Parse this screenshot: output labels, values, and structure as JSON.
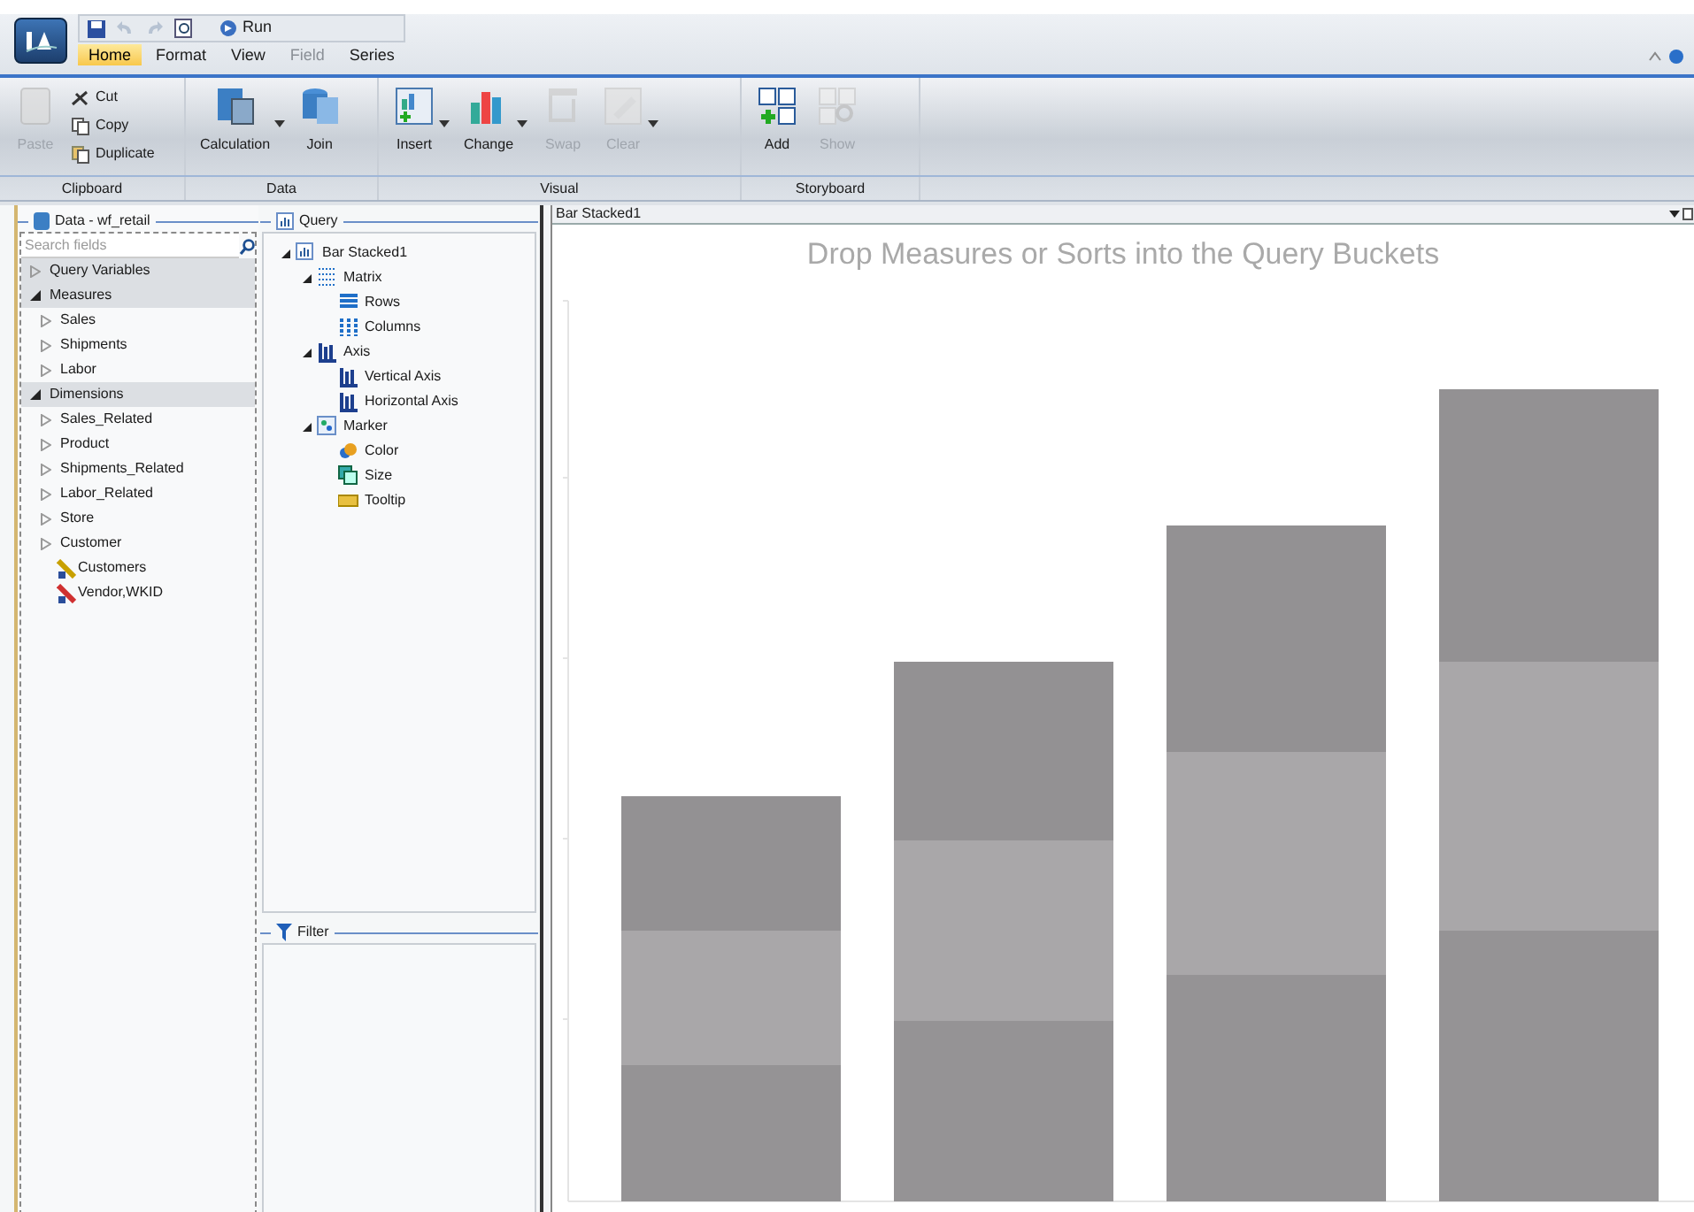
{
  "quick_access": {
    "run_label": "Run"
  },
  "tabs": [
    {
      "label": "Home",
      "selected": true,
      "disabled": false
    },
    {
      "label": "Format",
      "selected": false,
      "disabled": false
    },
    {
      "label": "View",
      "selected": false,
      "disabled": false
    },
    {
      "label": "Field",
      "selected": false,
      "disabled": true
    },
    {
      "label": "Series",
      "selected": false,
      "disabled": false
    }
  ],
  "ribbon_groups": [
    {
      "label": "Clipboard",
      "buttons": [
        {
          "label": "Paste",
          "kind": "large",
          "disabled": true
        },
        {
          "label": "Cut",
          "kind": "small",
          "disabled": false
        },
        {
          "label": "Copy",
          "kind": "small",
          "disabled": false
        },
        {
          "label": "Duplicate",
          "kind": "small",
          "disabled": false
        }
      ]
    },
    {
      "label": "Data",
      "buttons": [
        {
          "label": "Calculation",
          "kind": "large",
          "disabled": false,
          "dropdown": true
        },
        {
          "label": "Join",
          "kind": "large",
          "disabled": false
        }
      ]
    },
    {
      "label": "Visual",
      "buttons": [
        {
          "label": "Insert",
          "kind": "large",
          "disabled": false,
          "dropdown": true
        },
        {
          "label": "Change",
          "kind": "large",
          "disabled": false,
          "dropdown": true
        },
        {
          "label": "Swap",
          "kind": "large",
          "disabled": true
        },
        {
          "label": "Clear",
          "kind": "large",
          "disabled": true,
          "dropdown": true
        }
      ]
    },
    {
      "label": "Storyboard",
      "buttons": [
        {
          "label": "Add",
          "kind": "large",
          "disabled": false
        },
        {
          "label": "Show",
          "kind": "large",
          "disabled": true
        }
      ]
    }
  ],
  "data_panel": {
    "title": "Data - wf_retail",
    "search": {
      "placeholder": "Search fields"
    },
    "items": [
      {
        "label": "Query Variables",
        "kind": "category",
        "expanded": false
      },
      {
        "label": "Measures",
        "kind": "category",
        "expanded": true,
        "children": [
          {
            "label": "Sales",
            "kind": "folder",
            "expanded": false
          },
          {
            "label": "Shipments",
            "kind": "folder",
            "expanded": false
          },
          {
            "label": "Labor",
            "kind": "folder",
            "expanded": false
          }
        ]
      },
      {
        "label": "Dimensions",
        "kind": "category",
        "expanded": true,
        "children": [
          {
            "label": "Sales_Related",
            "kind": "folder",
            "expanded": false
          },
          {
            "label": "Product",
            "kind": "folder",
            "expanded": false
          },
          {
            "label": "Shipments_Related",
            "kind": "folder",
            "expanded": false
          },
          {
            "label": "Labor_Related",
            "kind": "folder",
            "expanded": false
          },
          {
            "label": "Store",
            "kind": "folder",
            "expanded": false
          },
          {
            "label": "Customer",
            "kind": "folder",
            "expanded": false
          },
          {
            "label": "Customers",
            "kind": "hierarchy",
            "color": "#c8a000"
          },
          {
            "label": "Vendor,WKID",
            "kind": "hierarchy",
            "color": "#d03030"
          }
        ]
      }
    ]
  },
  "query_panel": {
    "title": "Query",
    "tree": [
      {
        "label": "Bar Stacked1",
        "expanded": true,
        "children": [
          {
            "label": "Matrix",
            "expanded": true,
            "children": [
              {
                "label": "Rows"
              },
              {
                "label": "Columns"
              }
            ]
          },
          {
            "label": "Axis",
            "expanded": true,
            "children": [
              {
                "label": "Vertical Axis"
              },
              {
                "label": "Horizontal Axis"
              }
            ]
          },
          {
            "label": "Marker",
            "expanded": true,
            "children": [
              {
                "label": "Color"
              },
              {
                "label": "Size"
              },
              {
                "label": "Tooltip"
              }
            ]
          }
        ]
      }
    ]
  },
  "filter_panel": {
    "title": "Filter"
  },
  "canvas": {
    "title": "Bar Stacked1",
    "prompt": "Drop Measures or Sorts into the Query Buckets"
  }
}
